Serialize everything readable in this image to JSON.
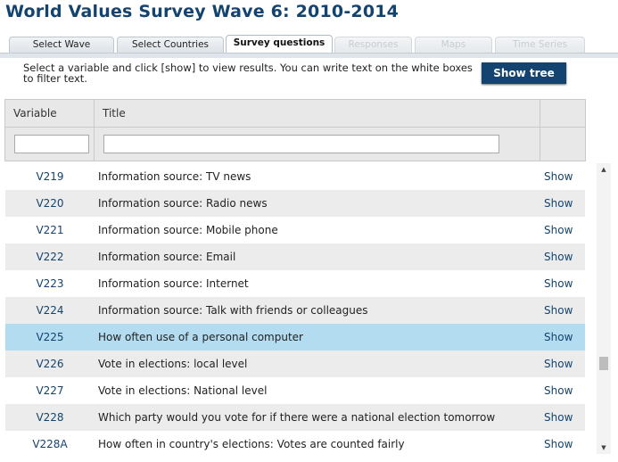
{
  "page": {
    "title": "World Values Survey Wave 6: 2010-2014"
  },
  "tabs": [
    {
      "label": "Select Wave",
      "state": "normal"
    },
    {
      "label": "Select Countries",
      "state": "normal"
    },
    {
      "label": "Survey questions",
      "state": "active"
    },
    {
      "label": "Responses",
      "state": "disabled"
    },
    {
      "label": "Maps",
      "state": "disabled"
    },
    {
      "label": "Time Series",
      "state": "disabled"
    }
  ],
  "instructions": "Select a variable and click [show] to view results. You can write text on the white boxes to filter text.",
  "show_tree_label": "Show tree",
  "table": {
    "headers": {
      "variable": "Variable",
      "title": "Title"
    },
    "filters": {
      "variable_value": "",
      "title_value": ""
    },
    "rows": [
      {
        "variable": "V219",
        "title": "Information source: TV news",
        "action": "Show"
      },
      {
        "variable": "V220",
        "title": "Information source: Radio news",
        "action": "Show"
      },
      {
        "variable": "V221",
        "title": "Information source: Mobile phone",
        "action": "Show"
      },
      {
        "variable": "V222",
        "title": "Information source: Email",
        "action": "Show"
      },
      {
        "variable": "V223",
        "title": "Information source: Internet",
        "action": "Show"
      },
      {
        "variable": "V224",
        "title": "Information source: Talk with friends or colleagues",
        "action": "Show"
      },
      {
        "variable": "V225",
        "title": "How often use of a personal computer",
        "action": "Show",
        "selected": true
      },
      {
        "variable": "V226",
        "title": "Vote in elections: local level",
        "action": "Show"
      },
      {
        "variable": "V227",
        "title": "Vote in elections: National level",
        "action": "Show"
      },
      {
        "variable": "V228",
        "title": "Which party would you vote for if there were a national election tomorrow",
        "action": "Show"
      },
      {
        "variable": "V228A",
        "title": "How often in country's elections: Votes are counted fairly",
        "action": "Show"
      }
    ]
  },
  "colors": {
    "accent": "#13436e",
    "selected_row": "#b3dcf1",
    "alt_row": "#ececec"
  }
}
